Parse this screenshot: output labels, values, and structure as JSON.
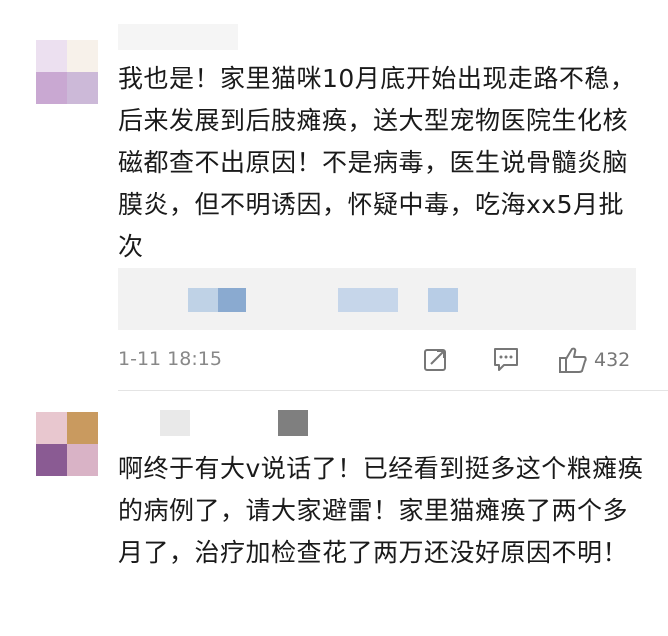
{
  "comments": [
    {
      "text": "我也是！家里猫咪10月底开始出现走路不稳，后来发展到后肢瘫痪，送大型宠物医院生化核磁都查不出原因！不是病毒，医生说骨髓炎脑膜炎，但不明诱因，怀疑中毒，吃海xx5月批次",
      "timestamp": "1-11 18:15",
      "likes": "432",
      "avatar_colors": [
        "#ece0f0",
        "#f7f1ea",
        "#c9a8d2",
        "#ccb9d8"
      ],
      "quote_blur_colors": [
        "#bfd2e6",
        "#8aaad0",
        "#c6d6ea",
        "#b8cde6"
      ]
    },
    {
      "text": "啊终于有大v说话了！已经看到挺多这个粮瘫痪的病例了，请大家避雷！家里猫瘫痪了两个多月了，治疗加检查花了两万还没好原因不明！",
      "avatar_colors": [
        "#e8c7cf",
        "#c99a5f",
        "#8a5b93",
        "#d9b3c6"
      ],
      "username_blur_colors": [
        "#e9e9e9",
        "#7f7f7f"
      ]
    }
  ],
  "icons": {
    "share": "share-icon",
    "reply": "comment-bubble-icon",
    "like": "thumbs-up-icon"
  }
}
